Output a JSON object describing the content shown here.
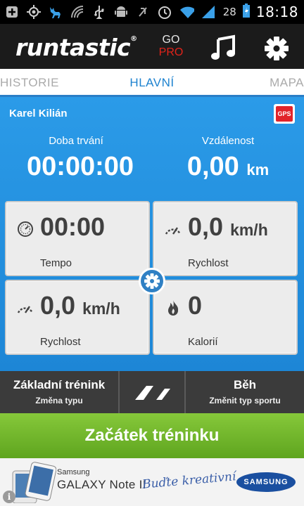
{
  "status_bar": {
    "icons": [
      "add-icon",
      "gps-target-icon",
      "deer-icon",
      "wireless-icon",
      "usb-icon",
      "android-icon",
      "mute-icon",
      "alarm-icon",
      "wifi-icon",
      "signal-icon",
      "battery-charging-icon"
    ],
    "battery_percent": "28",
    "time": "18:18"
  },
  "header": {
    "logo": "runtastic",
    "go_label": "GO",
    "pro_label": "PRO",
    "music_icon": "music-note-icon",
    "settings_icon": "gear-icon"
  },
  "tabs": [
    {
      "label": "HISTORIE"
    },
    {
      "label": "HLAVNÍ"
    },
    {
      "label": "MAPA"
    }
  ],
  "session": {
    "user_name": "Karel Kilián",
    "gps_badge": "GPS",
    "duration_label": "Doba trvání",
    "duration_value": "00:00:00",
    "distance_label": "Vzdálenost",
    "distance_value": "0,00",
    "distance_unit": "km"
  },
  "tiles": [
    {
      "icon": "stopwatch-icon",
      "value": "00:00",
      "unit": "",
      "label": "Tempo"
    },
    {
      "icon": "speedometer-icon",
      "value": "0,0",
      "unit": "km/h",
      "label": "Rychlost"
    },
    {
      "icon": "speedometer-icon",
      "value": "0,0",
      "unit": "km/h",
      "label": "Rychlost"
    },
    {
      "icon": "flame-icon",
      "value": "0",
      "unit": "",
      "label": "Kalorií"
    }
  ],
  "selector": {
    "training_title": "Základní trénink",
    "training_sub": "Změna typu",
    "sport_title": "Běh",
    "sport_sub": "Změnit typ sportu"
  },
  "start_button": "Začátek tréninku",
  "ad": {
    "brand_small": "Samsung",
    "product": "GALAXY Note II",
    "slogan": "Buďte kreativní",
    "logo": "SAMSUNG",
    "info": "i"
  },
  "colors": {
    "accent_blue": "#1f8fe0",
    "start_green": "#6cb22a",
    "pro_red": "#e2231a",
    "tab_active": "#1d82cf"
  }
}
